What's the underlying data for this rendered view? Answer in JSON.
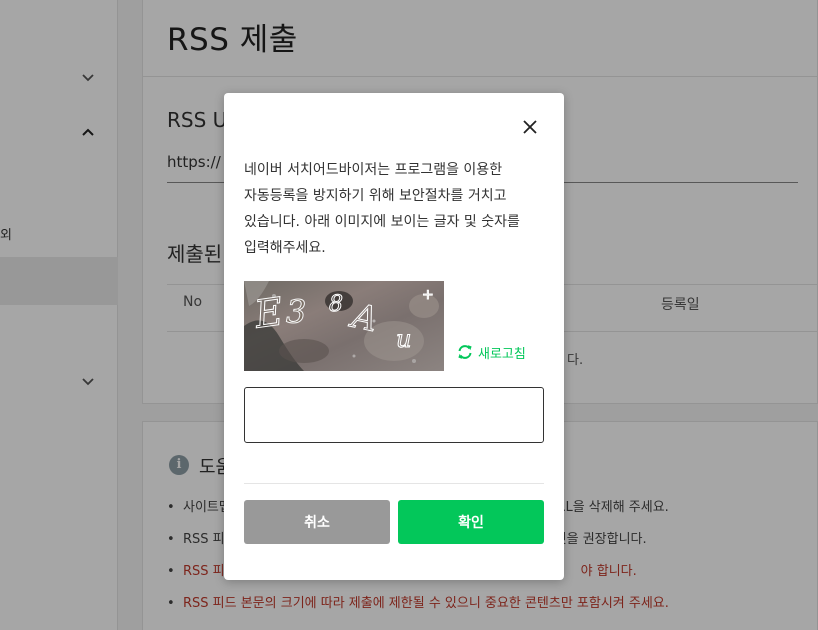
{
  "sidebar": {
    "partial_text": "외"
  },
  "page": {
    "title": "RSS 제출",
    "rss_label_partial": "RSS U",
    "rss_url_partial": "https://",
    "submitted_label_partial": "제출된",
    "table_headers": {
      "no": "No",
      "date": "등록일"
    },
    "empty_partial": "다."
  },
  "help": {
    "title_partial": "도움",
    "items": [
      {
        "text": "사이트맵",
        "tail": "경우 등록된 URL을 삭제해 주세요.",
        "red": false
      },
      {
        "text": "RSS 피",
        "tail": "것을 권장합니다.",
        "red": false
      },
      {
        "text": "RSS 피",
        "tail": "야 합니다.",
        "red": true
      },
      {
        "text": "RSS 피드 본문의 크기에 따라 제출에 제한될 수 있으니 중요한 콘텐츠만 포함시켜 주세요.",
        "tail": "",
        "red": true
      }
    ]
  },
  "modal": {
    "message": "네이버 서치어드바이저는 프로그램을 이용한 자동등록을 방지하기 위해 보안절차를 거치고 있습니다. 아래 이미지에 보이는 글자 및 숫자를 입력해주세요.",
    "refresh_label": "새로고침",
    "input_value": "",
    "input_placeholder": "",
    "cancel_label": "취소",
    "confirm_label": "확인",
    "accent_color": "#03c75a",
    "cancel_color": "#999999"
  }
}
